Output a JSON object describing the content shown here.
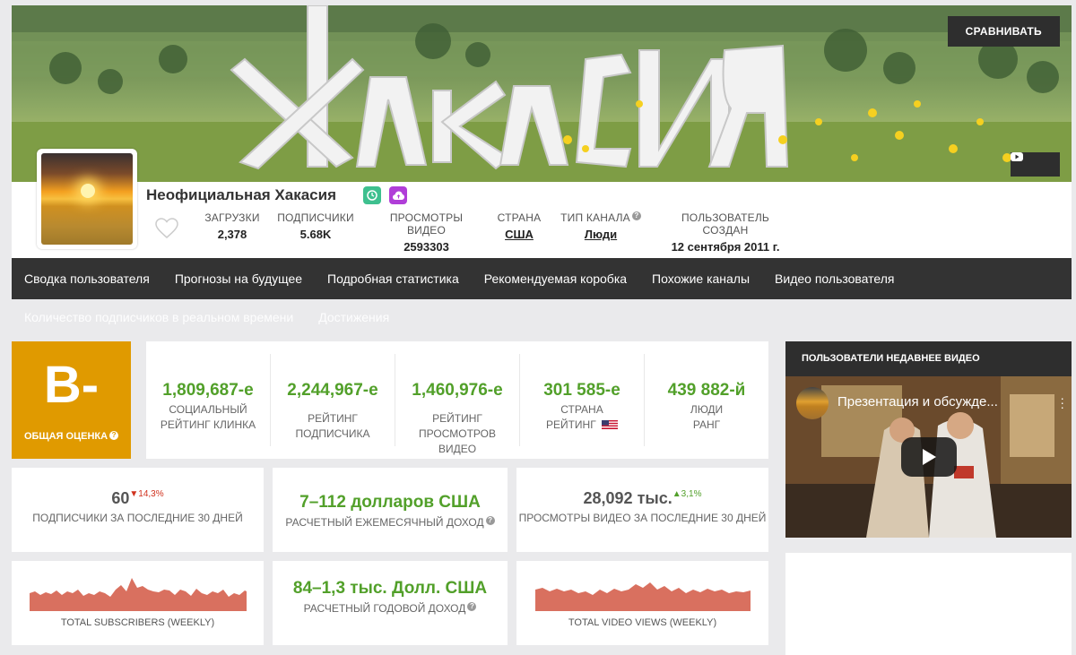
{
  "header": {
    "compare_label": "СРАВНИВАТЬ",
    "youtube_icon": "youtube-icon"
  },
  "channel": {
    "title": "Неофициальная Хакасия",
    "stats": [
      {
        "label": "ЗАГРУЗКИ",
        "value": "2,378"
      },
      {
        "label": "ПОДПИСЧИКИ",
        "value": "5.68K"
      },
      {
        "label": "ПРОСМОТРЫ ВИДЕО",
        "value": "2593303"
      },
      {
        "label": "СТРАНА",
        "value": "США"
      },
      {
        "label": "ТИП КАНАЛА",
        "value": "Люди"
      },
      {
        "label": "ПОЛЬЗОВАТЕЛЬ СОЗДАН",
        "value": "12 сентября 2011 г."
      }
    ]
  },
  "nav": {
    "items": [
      "Сводка пользователя",
      "Прогнозы на будущее",
      "Подробная статистика",
      "Рекомендуемая коробка",
      "Похожие каналы",
      "Видео пользователя"
    ],
    "sub_items": [
      "Количество подписчиков в реальном времени",
      "Достижения"
    ]
  },
  "grade": {
    "value": "B-",
    "label": "ОБЩАЯ ОЦЕНКА",
    "color": "#e09a00"
  },
  "ranks": [
    {
      "value": "1,809,687-е",
      "label1": "СОЦИАЛЬНЫЙ",
      "label2": "РЕЙТИНГ КЛИНКА",
      "label3": ""
    },
    {
      "value": "2,244,967-е",
      "label1": "",
      "label2": "РЕЙТИНГ",
      "label3": "ПОДПИСЧИКА"
    },
    {
      "value": "1,460,976-е",
      "label1": "",
      "label2": "РЕЙТИНГ",
      "label3": "ПРОСМОТРОВ ВИДЕО"
    },
    {
      "value": "301 585-е",
      "label1": "СТРАНА",
      "label2": "РЕЙТИНГ",
      "label3": ""
    },
    {
      "value": "439 882-й",
      "label1": "ЛЮДИ",
      "label2": "РАНГ",
      "label3": ""
    }
  ],
  "cards": {
    "subs30": {
      "value": "60",
      "delta": "▼14,3%",
      "label": "ПОДПИСЧИКИ ЗА ПОСЛЕДНИЕ 30 ДНЕЙ"
    },
    "monthly": {
      "value": "7–112 долларов США",
      "label": "РАСЧЕТНЫЙ ЕЖЕМЕСЯЧНЫЙ ДОХОД"
    },
    "views30": {
      "value": "28,092 тыс.",
      "delta": "▲3,1%",
      "label": "ПРОСМОТРЫ ВИДЕО ЗА ПОСЛЕДНИЕ 30 ДНЕЙ"
    },
    "subs_weekly": {
      "label": "TOTAL SUBSCRIBERS (WEEKLY)"
    },
    "yearly": {
      "value": "84–1,3 тыс. Долл. США",
      "label": "РАСЧЕТНЫЙ ГОДОВОЙ ДОХОД"
    },
    "views_weekly": {
      "label": "TOTAL VIDEO VIEWS (WEEKLY)"
    }
  },
  "video": {
    "header": "ПОЛЬЗОВАТЕЛИ НЕДАВНЕЕ ВИДЕО",
    "title": "Презентация и обсужде..."
  },
  "colors": {
    "green": "#52a02a",
    "nav_bg": "#333333",
    "spark_fill": "#d9705f"
  }
}
